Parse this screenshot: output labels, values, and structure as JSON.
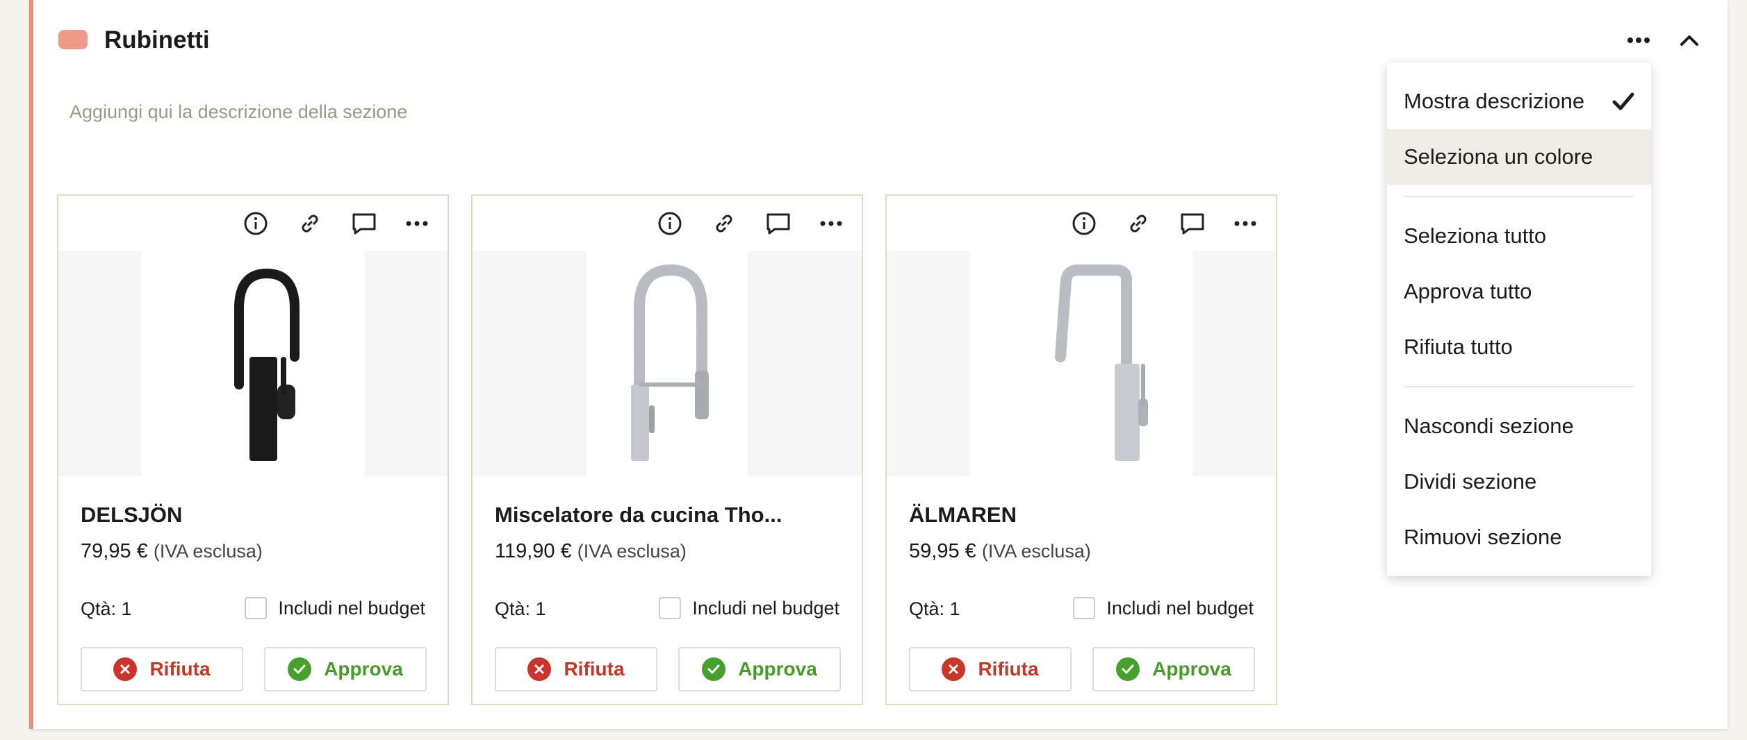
{
  "section": {
    "title": "Rubinetti",
    "color": "#ef9a88",
    "description_placeholder": "Aggiungi qui la descrizione della sezione"
  },
  "cards": [
    {
      "name": "DELSJÖN",
      "price": "79,95 €",
      "vat": "(IVA esclusa)",
      "qty": "Qtà: 1",
      "budget_label": "Includi nel budget",
      "reject_label": "Rifiuta",
      "approve_label": "Approva",
      "image": "black-faucet"
    },
    {
      "name": "Miscelatore da cucina Tho...",
      "price": "119,90 €",
      "vat": "(IVA esclusa)",
      "qty": "Qtà: 1",
      "budget_label": "Includi nel budget",
      "reject_label": "Rifiuta",
      "approve_label": "Approva",
      "image": "spring-faucet"
    },
    {
      "name": "ÄLMAREN",
      "price": "59,95 €",
      "vat": "(IVA esclusa)",
      "qty": "Qtà: 1",
      "budget_label": "Includi nel budget",
      "reject_label": "Rifiuta",
      "approve_label": "Approva",
      "image": "chrome-faucet"
    }
  ],
  "menu": {
    "items": [
      {
        "label": "Mostra descrizione",
        "checked": true
      },
      {
        "label": "Seleziona un colore",
        "highlighted": true
      },
      {
        "label": "Seleziona tutto"
      },
      {
        "label": "Approva tutto"
      },
      {
        "label": "Rifiuta tutto"
      },
      {
        "label": "Nascondi sezione"
      },
      {
        "label": "Dividi sezione"
      },
      {
        "label": "Rimuovi sezione"
      }
    ]
  },
  "colors": {
    "accent_border": "#ef8e80",
    "reject": "#c9352a",
    "approve": "#47a02e"
  }
}
